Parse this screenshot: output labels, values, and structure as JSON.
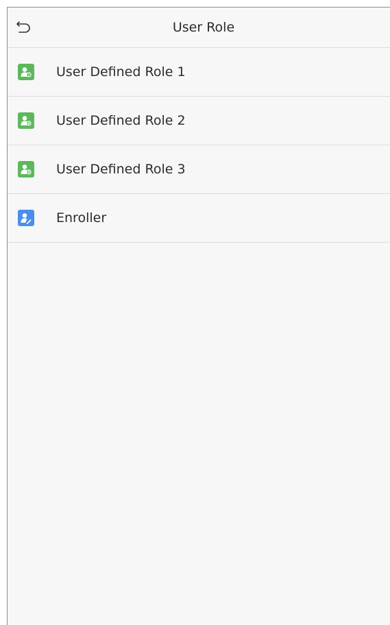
{
  "header": {
    "title": "User Role",
    "back_icon": "back-arrow-icon"
  },
  "roles": [
    {
      "label": "User Defined Role 1",
      "icon": "user-role-1-icon",
      "color": "#5cb85c"
    },
    {
      "label": "User Defined Role 2",
      "icon": "user-role-2-icon",
      "color": "#5cb85c"
    },
    {
      "label": "User Defined Role 3",
      "icon": "user-role-3-icon",
      "color": "#5cb85c"
    },
    {
      "label": "Enroller",
      "icon": "enroller-icon",
      "color": "#4a8ef0"
    }
  ]
}
